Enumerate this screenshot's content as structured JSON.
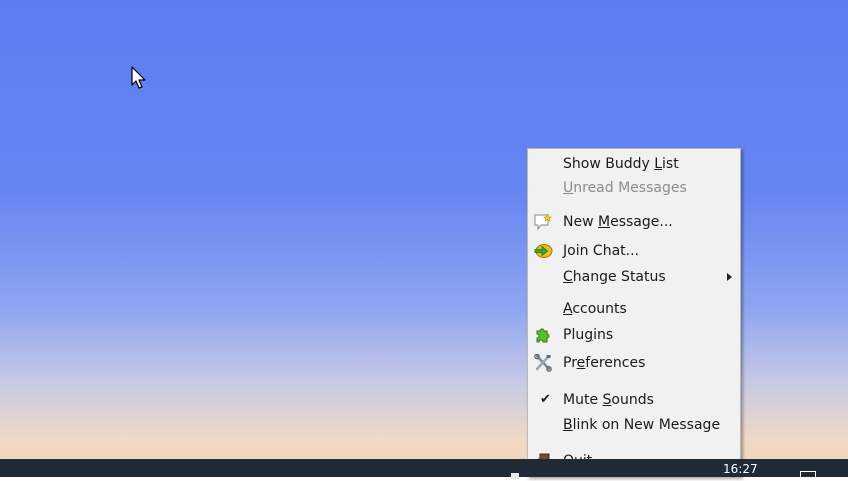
{
  "taskbar": {
    "clock": "16:27"
  },
  "tray_menu": {
    "items": [
      {
        "label_pre": "Show Buddy ",
        "label_u": "L",
        "label_post": "ist",
        "enabled": true
      },
      {
        "label_pre": "",
        "label_u": "U",
        "label_post": "nread Messages",
        "enabled": false
      },
      {
        "label_pre": "New ",
        "label_u": "M",
        "label_post": "essage...",
        "enabled": true,
        "icon": "new-message-icon"
      },
      {
        "label_pre": "",
        "label_u": "J",
        "label_post": "oin Chat...",
        "enabled": true,
        "icon": "join-chat-icon"
      },
      {
        "label_pre": "",
        "label_u": "C",
        "label_post": "hange Status",
        "enabled": true,
        "submenu": true
      },
      {
        "label_pre": "",
        "label_u": "A",
        "label_post": "ccounts",
        "enabled": true
      },
      {
        "label_pre": "Plu",
        "label_u": "g",
        "label_post": "ins",
        "enabled": true,
        "icon": "plugin-puzzle-icon"
      },
      {
        "label_pre": "Pr",
        "label_u": "e",
        "label_post": "ferences",
        "enabled": true,
        "icon": "preferences-tools-icon"
      },
      {
        "label_pre": "Mute ",
        "label_u": "S",
        "label_post": "ounds",
        "enabled": true,
        "checked": true
      },
      {
        "label_pre": "",
        "label_u": "B",
        "label_post": "link on New Message",
        "enabled": true
      },
      {
        "label_pre": "",
        "label_u": "Q",
        "label_post": "uit",
        "enabled": true,
        "icon": "quit-icon"
      }
    ]
  },
  "colors": {
    "menu_background": "#f1f1f1",
    "taskbar": "#1f2a36",
    "disabled_text": "#8c8c8c"
  }
}
